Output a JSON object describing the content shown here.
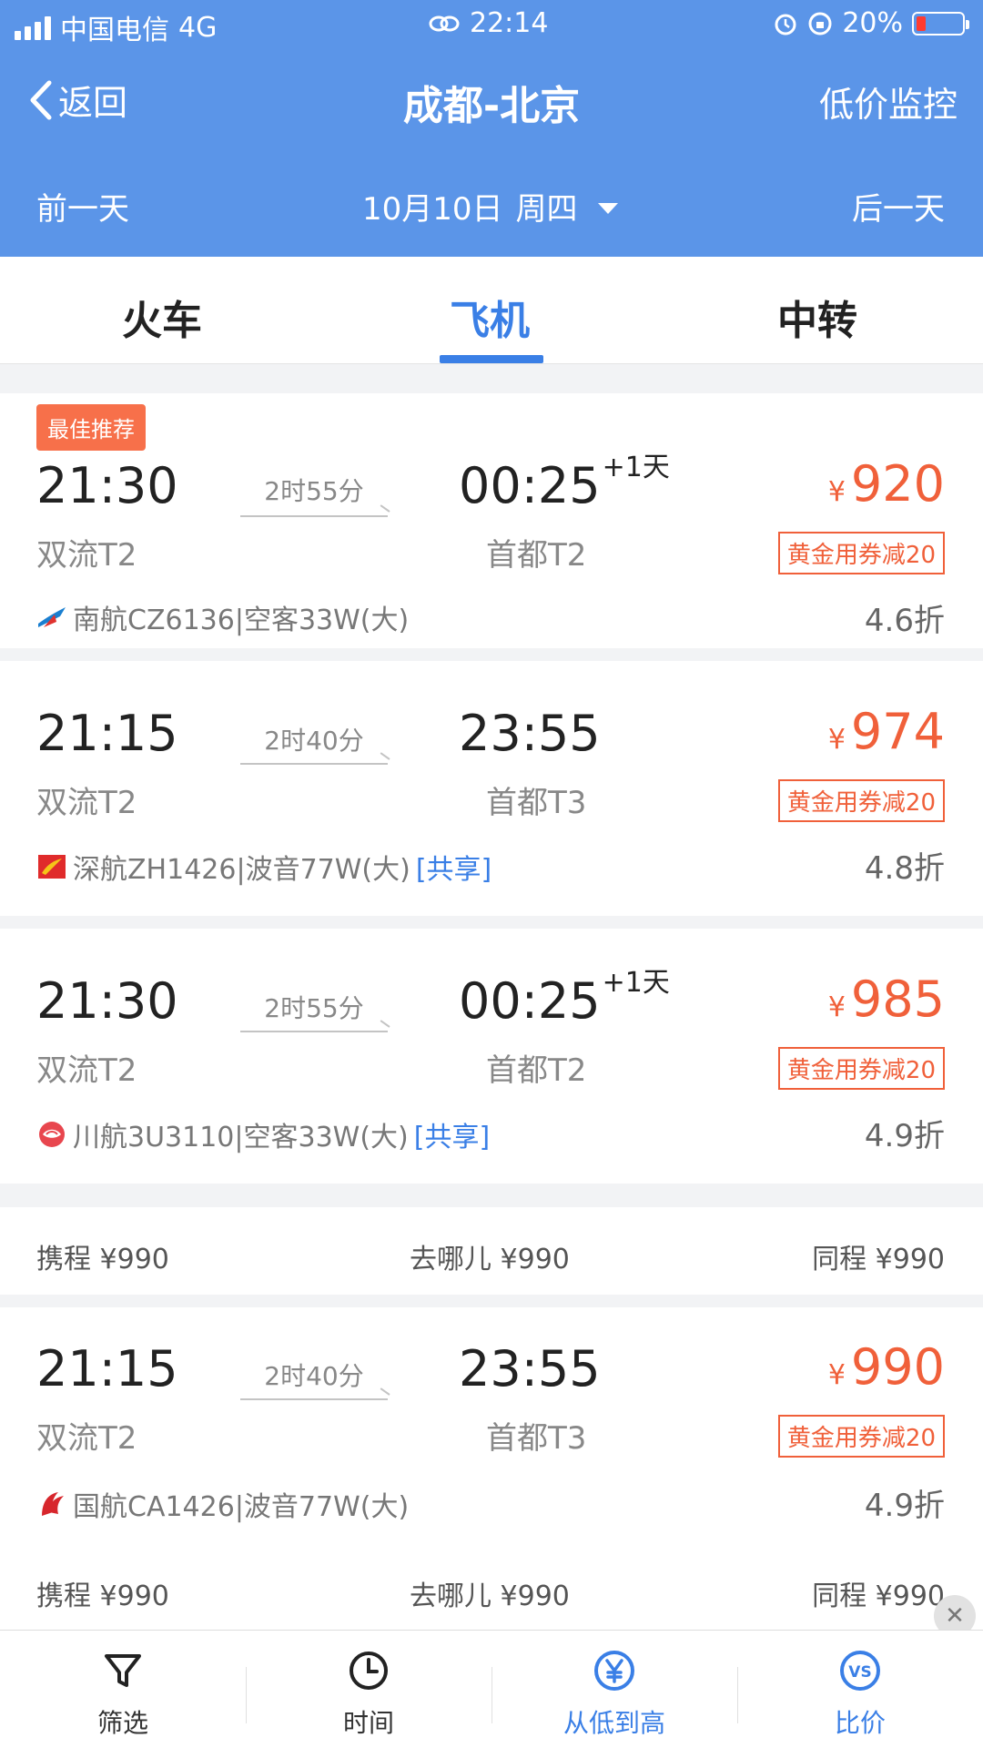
{
  "status": {
    "carrier": "中国电信",
    "network": "4G",
    "time": "22:14",
    "battery": "20%",
    "battery_level": 0.2
  },
  "header": {
    "back_label": "返回",
    "title": "成都-北京",
    "right_action": "低价监控",
    "prev_day": "前一天",
    "date": "10月10日",
    "weekday": "周四",
    "next_day": "后一天"
  },
  "tabs": [
    {
      "label": "火车",
      "active": false
    },
    {
      "label": "飞机",
      "active": true
    },
    {
      "label": "中转",
      "active": false
    }
  ],
  "flights": [
    {
      "badge": "最佳推荐",
      "dep_time": "21:30",
      "duration": "2时55分",
      "arr_time": "00:25",
      "next_day": "+1天",
      "dep_airport": "双流T2",
      "arr_airport": "首都T2",
      "price_symbol": "¥",
      "price": "920",
      "coupon": "黄金用券减20",
      "airline": "南航CZ6136|空客33W(大)",
      "share": "",
      "discount": "4.6折",
      "logo": "china-southern-logo"
    },
    {
      "badge": "",
      "dep_time": "21:15",
      "duration": "2时40分",
      "arr_time": "23:55",
      "next_day": "",
      "dep_airport": "双流T2",
      "arr_airport": "首都T3",
      "price_symbol": "¥",
      "price": "974",
      "coupon": "黄金用券减20",
      "airline": "深航ZH1426|波音77W(大)",
      "share": "[共享]",
      "discount": "4.8折",
      "logo": "shenzhen-airlines-logo"
    },
    {
      "badge": "",
      "dep_time": "21:30",
      "duration": "2时55分",
      "arr_time": "00:25",
      "next_day": "+1天",
      "dep_airport": "双流T2",
      "arr_airport": "首都T2",
      "price_symbol": "¥",
      "price": "985",
      "coupon": "黄金用券减20",
      "airline": "川航3U3110|空客33W(大)",
      "share": "[共享]",
      "discount": "4.9折",
      "logo": "sichuan-airlines-logo"
    },
    {
      "badge": "",
      "dep_time": "21:15",
      "duration": "2时40分",
      "arr_time": "23:55",
      "next_day": "",
      "dep_airport": "双流T2",
      "arr_airport": "首都T3",
      "price_symbol": "¥",
      "price": "990",
      "coupon": "黄金用券减20",
      "airline": "国航CA1426|波音77W(大)",
      "share": "",
      "discount": "4.9折",
      "logo": "air-china-logo"
    }
  ],
  "compare_rows": [
    {
      "ctrip": "携程 ¥990",
      "qunar": "去哪儿 ¥990",
      "ly": "同程 ¥990"
    },
    {
      "ctrip": "携程 ¥990",
      "qunar": "去哪儿 ¥990",
      "ly": "同程 ¥990"
    }
  ],
  "bottom_bar": [
    {
      "label": "筛选",
      "icon": "filter-icon",
      "active": false
    },
    {
      "label": "时间",
      "icon": "clock-icon",
      "active": false
    },
    {
      "label": "从低到高",
      "icon": "yen-sort-icon",
      "active": true
    },
    {
      "label": "比价",
      "icon": "vs-icon",
      "active": true
    }
  ],
  "colors": {
    "header_blue": "#5b95e8",
    "accent_blue": "#3a7fe6",
    "price_orange": "#f0603a",
    "badge_orange": "#f7704a"
  }
}
